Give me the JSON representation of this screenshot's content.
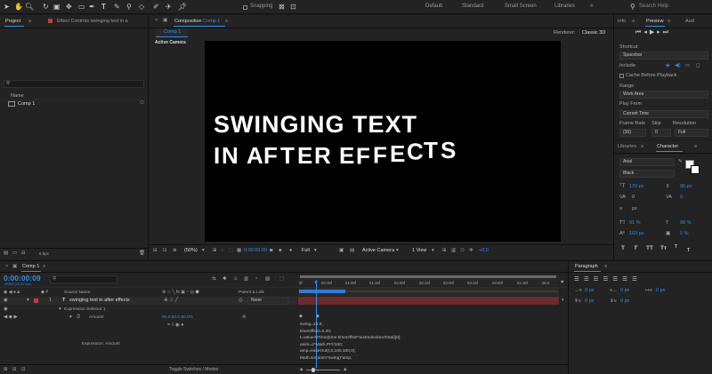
{
  "toolbar": {
    "snapping": "Snapping",
    "workspaces": [
      "Default",
      "Standard",
      "Small Screen",
      "Libraries"
    ],
    "active_workspace": "Standard",
    "search_placeholder": "Search Help"
  },
  "project_panel": {
    "tab": "Project",
    "effect_controls_tab": "Effect Controls swinging text in a",
    "search_placeholder": "",
    "column_name": "Name",
    "items": [
      "Comp 1"
    ],
    "bpc": "8 bpc"
  },
  "composition_panel": {
    "tab_prefix": "Composition",
    "tab_comp": "Comp 1",
    "sub_tab": "Comp 1",
    "renderer_label": "Renderer:",
    "renderer_value": "Classic 3D",
    "active_camera": "Active Camera",
    "text_line1": "SWINGING TEXT",
    "text_line2": "IN AFTER EFFECTS",
    "footer": {
      "zoom": "(50%)",
      "timecode": "0:00:00:09",
      "resolution": "Full",
      "view": "Active Camera",
      "views": "1 View",
      "exposure": "+0.0"
    }
  },
  "info_panel": {
    "tabs": [
      "Info",
      "Preview",
      "Aud"
    ],
    "active_tab": "Preview",
    "shortcut_label": "Shortcut",
    "shortcut_value": "Spacebar",
    "include_label": "Include:",
    "cache_label": "Cache Before Playback",
    "range_label": "Range",
    "range_value": "Work Area",
    "play_from_label": "Play From",
    "play_from_value": "Current Time",
    "frame_rate_label": "Frame Rate",
    "skip_label": "Skip",
    "resolution_label": "Resolution",
    "frame_rate_value": "(30)",
    "skip_value": "0",
    "resolution_value": "Full"
  },
  "character_panel": {
    "tabs": [
      "Libraries",
      "Character"
    ],
    "active_tab": "Character",
    "font": "Arial",
    "style": "Black",
    "size": "170 px",
    "leading": "96 px",
    "kerning": "0",
    "tracking": "0",
    "stroke_unit": "px",
    "vscale": "91 %",
    "hscale": "98 %",
    "baseline": "103 px",
    "tsume": "0 %",
    "style_buttons": [
      "T",
      "T",
      "TT",
      "Tт",
      "T",
      "T"
    ]
  },
  "paragraph_panel": {
    "tab": "Paragraph",
    "values": [
      "0 px",
      "0 px",
      "0 px",
      "0 px",
      "0 px"
    ]
  },
  "timeline": {
    "tab": "Comp 1",
    "current_time": "0:00:00:09",
    "current_time_sub": "00009 (30.00 fps)",
    "search_placeholder": "",
    "columns": {
      "source_name": "Source Name",
      "parent": "Parent & Link"
    },
    "layer": {
      "number": "1",
      "name": "swinging text in after effects",
      "parent": "None"
    },
    "expression_selector": "Expression Selector 1",
    "amount_label": "Amount",
    "amount_value": "90.0,90.0,90.0%",
    "expression_label": "Expression: Amount",
    "ruler": [
      "0f",
      "00:15f",
      "01:00f",
      "01:15f",
      "02:00f",
      "02:15f",
      "03:00f",
      "03:15f",
      "04:00f",
      "04:15f",
      "05:0"
    ],
    "code_lines": [
      "swing=13.5;",
      "timeOffset=0.20;",
      "t=valueAtTime(time-timeOffset*textIndex/textTotal)[0];",
      "anim=2*Math.PI*t/100;",
      "amp=easeOut(t,0,100,100,0);",
      "Math.sin(anim*swing)*amp;"
    ],
    "toggle_label": "Toggle Switches / Modes"
  },
  "colors": {
    "accent": "#2d8ceb",
    "layer_red": "#c43a3f",
    "track_red": "#6b2b2e",
    "work_area": "#2f7dd7"
  }
}
